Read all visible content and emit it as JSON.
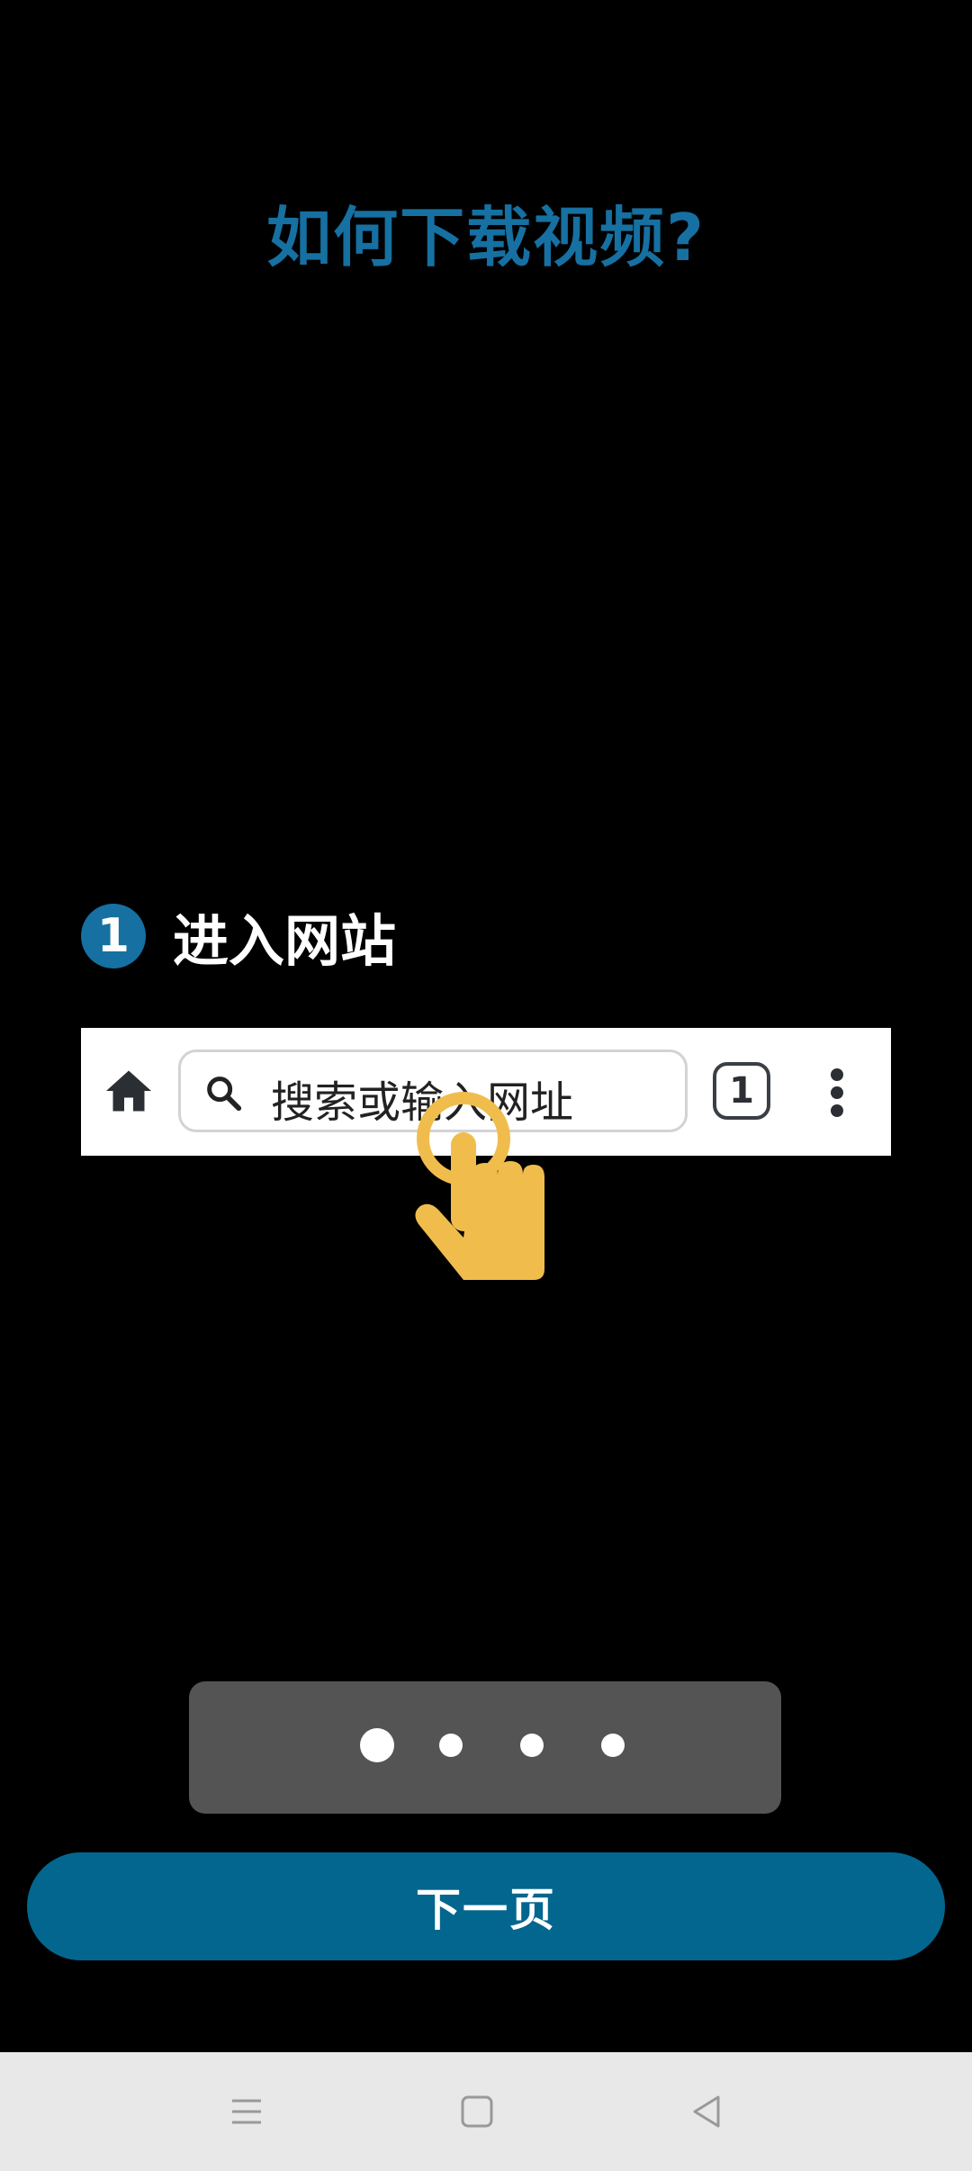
{
  "title": "如何下载视频?",
  "step": {
    "number": "1",
    "label": "进入网站"
  },
  "browser_bar": {
    "search_placeholder": "搜索或输入网址",
    "tab_count": "1"
  },
  "pager": {
    "page_count": 4,
    "current_index": 0
  },
  "next_button": {
    "label": "下一页"
  },
  "icons": [
    "home-icon",
    "search-icon",
    "tabs-icon",
    "more-vert-icon",
    "hand-pointer-icon",
    "menu-icon",
    "home-square-icon",
    "back-icon"
  ],
  "colors": {
    "accent": "#1670a1",
    "button": "#03668f",
    "hand": "#f0bd4c",
    "pager_bg": "#545454"
  }
}
